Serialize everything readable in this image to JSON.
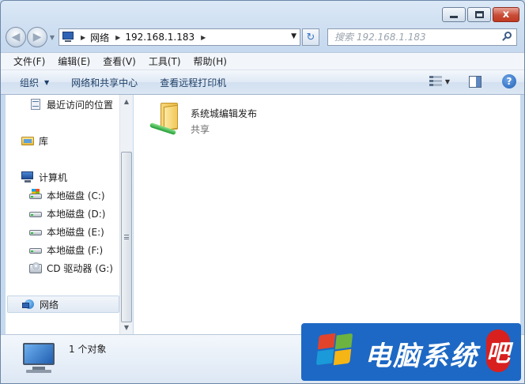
{
  "window": {
    "caption": {
      "close_glyph": "x"
    }
  },
  "address": {
    "back_glyph": "◀",
    "forward_glyph": "▶",
    "crumbs": [
      "网络",
      "192.168.1.183"
    ],
    "refresh_glyph": "↻"
  },
  "search": {
    "placeholder": "搜索 192.168.1.183"
  },
  "menu": {
    "items": [
      "文件(F)",
      "编辑(E)",
      "查看(V)",
      "工具(T)",
      "帮助(H)"
    ]
  },
  "commands": {
    "organize": "组织",
    "network_center": "网络和共享中心",
    "remote_printers": "查看远程打印机",
    "help_glyph": "?"
  },
  "nav": {
    "items": [
      {
        "label": "最近访问的位置",
        "icon": "recent-places-icon"
      },
      {
        "label": "库",
        "icon": "library-icon"
      },
      {
        "label": "计算机",
        "icon": "computer-icon"
      },
      {
        "label": "本地磁盘 (C:)",
        "icon": "system-drive-icon"
      },
      {
        "label": "本地磁盘 (D:)",
        "icon": "drive-icon"
      },
      {
        "label": "本地磁盘 (E:)",
        "icon": "drive-icon"
      },
      {
        "label": "本地磁盘 (F:)",
        "icon": "drive-icon"
      },
      {
        "label": "CD 驱动器 (G:)",
        "icon": "cd-drive-icon"
      },
      {
        "label": "网络",
        "icon": "network-icon"
      }
    ]
  },
  "content": {
    "items": [
      {
        "name": "系统城编辑发布",
        "subtitle": "共享",
        "icon": "shared-folder-icon"
      }
    ]
  },
  "details": {
    "count": "1 个对象"
  },
  "watermark": {
    "text": "电脑系统",
    "last_char": "吧"
  },
  "colors": {
    "accent": "#1d68c4",
    "command_text": "#1e3f66",
    "close_button": "#c74c36",
    "badge_red": "#d8201f"
  }
}
